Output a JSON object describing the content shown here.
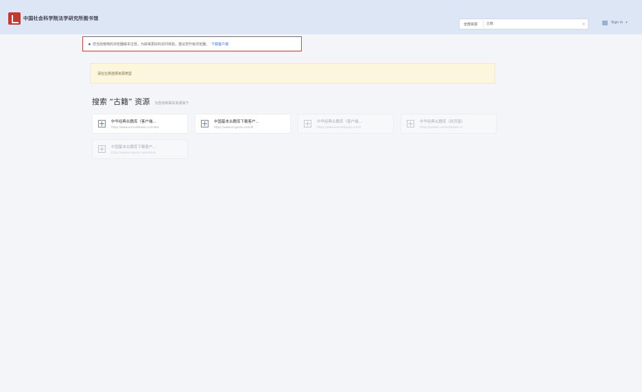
{
  "header": {
    "logo_text": "中国社会科学院法学研究所图书馆",
    "search": {
      "scope_label": "全部资源",
      "placeholder": "古籍",
      "clear_glyph": "×"
    },
    "user": {
      "name_label": "Sign in",
      "caret": "▾"
    }
  },
  "notice": {
    "text": "您当前使用的浏览器版本过低，为获得更好的访问体验，建议您升级浏览器。",
    "link_label": "下载客户端"
  },
  "tip": {
    "text": "请在左侧选择资源类型"
  },
  "section": {
    "title": "搜索 “古籍” 资源",
    "subtitle": "为您找到相关资源如下"
  },
  "cards": [
    {
      "title": "中华经典古籍库（客户端...",
      "url": "https://www.ancientbooks.cn/index",
      "dim": false
    },
    {
      "title": "中国基本古籍库下载客户...",
      "url": "https://www.er-gushu.com/dl",
      "dim": false
    },
    {
      "title": "中华经典古籍库（客户端...",
      "url": "https://www.ancientbooks.cn/v2",
      "dim": true
    },
    {
      "title": "中华经典古籍库（网页版）",
      "url": "https://publish.ancientbooks.cn",
      "dim": true
    },
    {
      "title": "中国基本古籍库下载客户...",
      "url": "https://www.er-gushu.com/client",
      "dim": true
    }
  ]
}
